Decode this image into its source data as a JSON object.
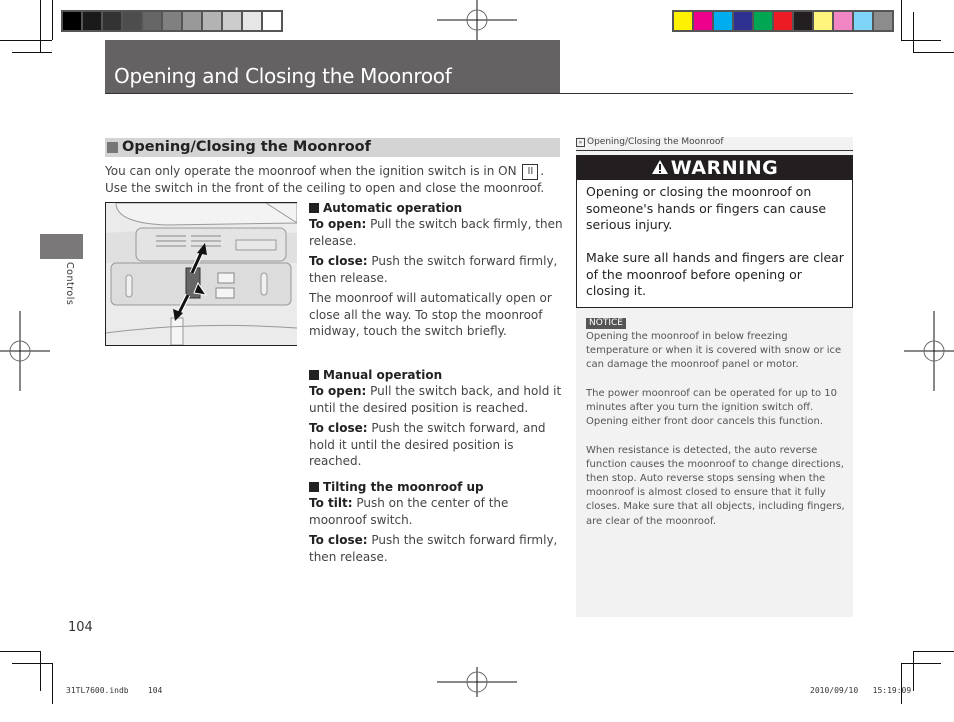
{
  "header": {
    "title": "Opening and Closing the Moonroof"
  },
  "side_tab": {
    "label": "Controls"
  },
  "print_marks": {
    "grayscale_swatches": [
      "#000000",
      "#1a1a1a",
      "#333333",
      "#4d4d4d",
      "#666666",
      "#808080",
      "#999999",
      "#b3b3b3",
      "#cccccc",
      "#e6e6e6",
      "#ffffff"
    ],
    "color_swatches": [
      "#fff200",
      "#ec008c",
      "#00aeef",
      "#2e3192",
      "#00a651",
      "#ed1c24",
      "#231f20",
      "#fff57c",
      "#f286c4",
      "#7dd4f6",
      "#8c8c8c"
    ]
  },
  "section": {
    "heading": "Opening/Closing the Moonroof",
    "intro_before": "You can only operate the moonroof when the ignition switch is in ON",
    "ignition_position": "II",
    "intro_after": ". Use the switch in the front of the ceiling to open and close the moonroof."
  },
  "automatic": {
    "heading": "Automatic operation",
    "open_label": "To open:",
    "open_text": " Pull the switch back firmly, then release.",
    "close_label": "To close:",
    "close_text": " Push the switch forward firmly, then release.",
    "note": "The moonroof will automatically open or close all the way. To stop the moonroof midway, touch the switch briefly."
  },
  "manual": {
    "heading": "Manual operation",
    "open_label": "To open:",
    "open_text": " Pull the switch back, and hold it until the desired position is reached.",
    "close_label": "To close:",
    "close_text": " Push the switch forward, and hold it until the desired position is reached."
  },
  "tilting": {
    "heading": "Tilting the moonroof up",
    "tilt_label": "To tilt:",
    "tilt_text": " Push on the center of the moonroof switch.",
    "close_label": "To close:",
    "close_text": " Push the switch forward firmly, then release."
  },
  "sidebar": {
    "reference": "Opening/Closing the Moonroof",
    "warning_title": "WARNING",
    "warning_paragraphs": [
      "Opening or closing the moonroof on someone's hands or fingers can cause serious injury.",
      "Make sure all hands and fingers are clear of the moonroof before opening or closing it."
    ],
    "notice_label": "NOTICE",
    "notice_text": "Opening the moonroof in below freezing temperature or when it is covered with snow or ice can damage the moonroof panel or motor.",
    "notes": [
      "The power moonroof can be operated for up to 10 minutes after you turn the ignition switch off. Opening either front door cancels this function.",
      "When resistance is detected, the auto reverse function causes the moonroof to change directions, then stop. Auto reverse stops sensing when the moonroof is almost closed to ensure that it fully closes. Make sure that all objects, including fingers, are clear of the moonroof."
    ]
  },
  "footer": {
    "page_number": "104",
    "slug_file": "31TL7600.indb",
    "slug_page": "104",
    "slug_date": "2010/09/10",
    "slug_time": "15:19:09"
  }
}
